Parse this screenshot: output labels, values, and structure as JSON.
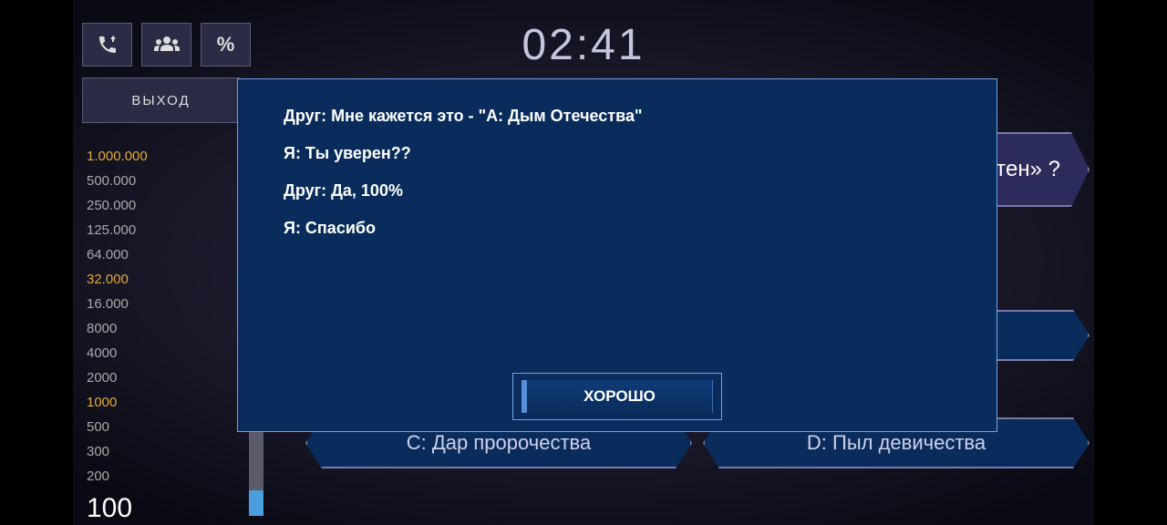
{
  "timer": "02:41",
  "exit_label": "ВЫХОД",
  "prizes": [
    {
      "label": "1.000.000",
      "cls": "top"
    },
    {
      "label": "500.000",
      "cls": ""
    },
    {
      "label": "250.000",
      "cls": ""
    },
    {
      "label": "125.000",
      "cls": ""
    },
    {
      "label": "64.000",
      "cls": ""
    },
    {
      "label": "32.000",
      "cls": "safe"
    },
    {
      "label": "16.000",
      "cls": ""
    },
    {
      "label": "8000",
      "cls": ""
    },
    {
      "label": "4000",
      "cls": ""
    },
    {
      "label": "2000",
      "cls": ""
    },
    {
      "label": "1000",
      "cls": "safe"
    },
    {
      "label": "500",
      "cls": ""
    },
    {
      "label": "300",
      "cls": ""
    },
    {
      "label": "200",
      "cls": ""
    }
  ],
  "current_amount": "100",
  "dialogue_lines": [
    "Друг: Мне кажется это - \"А: Дым Отечества\"",
    "Я: Ты уверен??",
    "Друг: Да, 100%",
    "Я: Спасибо"
  ],
  "ok_label": "ХОРОШО",
  "question_fragment": "ятен» ?",
  "answers": {
    "c": "C: Дар пророчества",
    "d": "D: Пыл девичества"
  }
}
